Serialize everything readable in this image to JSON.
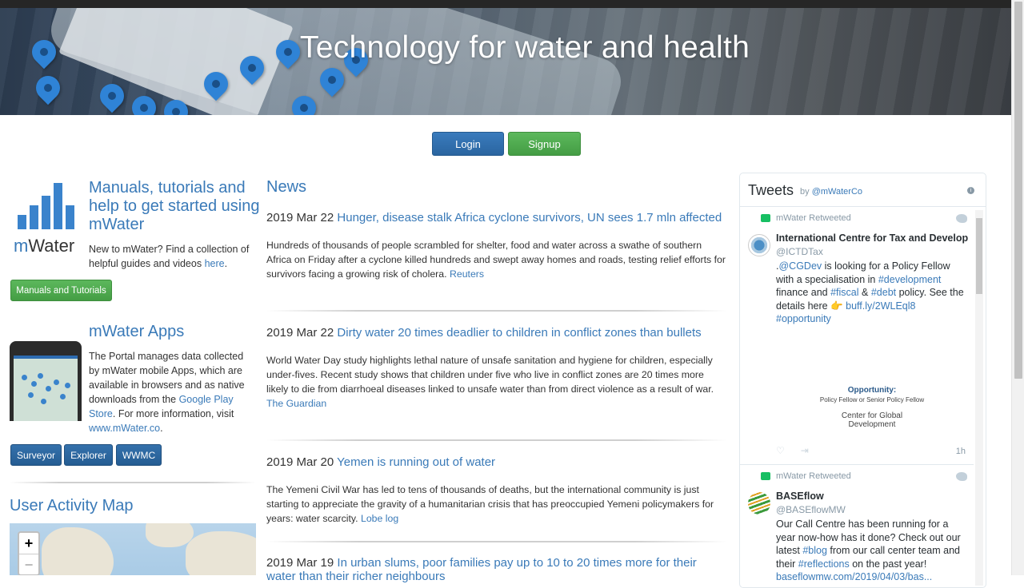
{
  "hero": {
    "title": "Technology for water and health"
  },
  "auth": {
    "login_label": "Login",
    "signup_label": "Signup"
  },
  "manuals": {
    "title": "Manuals, tutorials and help to get started using mWater",
    "logo_text_prefix": "m",
    "logo_text_suffix": "Water",
    "text": "New to mWater? Find a collection of helpful guides and videos ",
    "link": "here",
    "text_end": ".",
    "button_label": "Manuals and Tutorials"
  },
  "apps": {
    "title": "mWater Apps",
    "text1": "The Portal manages data collected by mWater mobile Apps, which are available in browsers and as native downloads from the ",
    "link1": "Google Play Store",
    "text2": ". For more information, visit ",
    "link2": "www.mWater.co",
    "text3": ".",
    "buttons": [
      "Surveyor",
      "Explorer",
      "WWMC"
    ]
  },
  "activity_map": {
    "title": "User Activity Map",
    "zoom_in": "+",
    "zoom_out": "−"
  },
  "news": {
    "title": "News",
    "items": [
      {
        "date": "2019 Mar 22",
        "headline": "Hunger, disease stalk Africa cyclone survivors, UN sees 1.7 mln affected",
        "body": "Hundreds of thousands of people scrambled for shelter, food and water across a swathe of southern Africa on Friday after a cyclone killed hundreds and swept away homes and roads, testing relief efforts for survivors facing a growing risk of cholera.",
        "source": "Reuters"
      },
      {
        "date": "2019 Mar 22",
        "headline": "Dirty water 20 times deadlier to children in conflict zones than bullets",
        "body": "World Water Day study highlights lethal nature of unsafe sanitation and hygiene for children, especially under-fives. Recent study shows that children under five who live in conflict zones are 20 times more likely to die from diarrhoeal diseases linked to unsafe water than from direct violence as a result of war.",
        "source": "The Guardian"
      },
      {
        "date": "2019 Mar 20",
        "headline": "Yemen is running out of water",
        "body": "The Yemeni Civil War has led to tens of thousands of deaths, but the international community is just starting to appreciate the gravity of a humanitarian crisis that has preoccupied Yemeni policymakers for years: water scarcity.",
        "source": "Lobe log"
      },
      {
        "date": "2019 Mar 19",
        "headline": "In urban slums, poor families pay up to 10 to 20 times more for their water than their richer neighbours",
        "body": "",
        "source": ""
      }
    ]
  },
  "tweets": {
    "title": "Tweets",
    "by": "by ",
    "account": "@mWaterCo",
    "items": [
      {
        "retweeted": "mWater Retweeted",
        "name": "International Centre for Tax and Development",
        "handle": "@ICTDTax",
        "t1": ".",
        "m1": "@CGDev",
        "t2": " is looking for a Policy Fellow with a specialisation in ",
        "h1": "#development",
        "t3": " finance and ",
        "h2": "#fiscal",
        "t4": " & ",
        "h3": "#debt",
        "t5": " policy. See the details here 👉 ",
        "l1": "buff.ly/2WLEql8",
        "t6": " ",
        "h4": "#opportunity",
        "card_title": "Opportunity:",
        "card_sub": "Policy Fellow or Senior Policy Fellow",
        "card_org": "Center for Global Development",
        "time": "1h"
      },
      {
        "retweeted": "mWater Retweeted",
        "name": "BASEflow",
        "handle": "@BASEflowMW",
        "t1": "Our Call Centre has been running for a year now-how has it done? Check out our latest ",
        "h1": "#blog",
        "t2": " from our call center team and their ",
        "h2": "#reflections",
        "t3": " on the past year! ",
        "l1": "baseflowmw.com/2019/04/03/bas..."
      }
    ]
  },
  "colors": {
    "link": "#3a7ab8",
    "primary_button": "#2a65a0",
    "success_button": "#449d44"
  }
}
